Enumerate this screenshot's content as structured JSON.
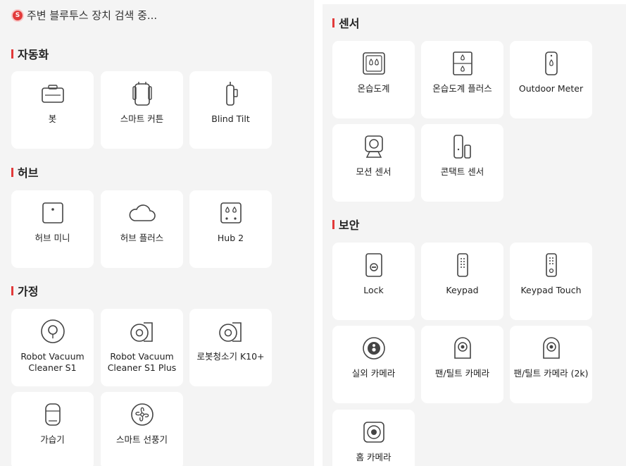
{
  "left": {
    "scan_dot": "S",
    "scan_text": "주변 블루투스 장치 검색 중...",
    "sections": [
      {
        "title": "자동화",
        "items": [
          "봇",
          "스마트 커튼",
          "Blind Tilt"
        ]
      },
      {
        "title": "허브",
        "items": [
          "허브 미니",
          "허브 플러스",
          "Hub 2"
        ]
      },
      {
        "title": "가정",
        "items": [
          "Robot Vacuum Cleaner S1",
          "Robot Vacuum Cleaner S1 Plus",
          "로봇청소기 K10+",
          "가습기",
          "스마트 선풍기"
        ]
      }
    ]
  },
  "right": {
    "sections": [
      {
        "title": "센서",
        "items": [
          "온습도계",
          "온습도계 플러스",
          "Outdoor Meter",
          "모션 센서",
          "콘택트 센서"
        ]
      },
      {
        "title": "보안",
        "items": [
          "Lock",
          "Keypad",
          "Keypad Touch",
          "실외 카메라",
          "팬/틸트 카메라",
          "팬/틸트 카메라 (2k)",
          "홈 카메라"
        ]
      }
    ]
  },
  "colors": {
    "accent": "#e23a3a",
    "card": "#ffffff",
    "panel": "#f4f4f4"
  },
  "icons": {
    "bot": "bot-icon",
    "curtain": "curtain-icon",
    "blind_tilt": "blind-tilt-icon",
    "hub_mini": "hub-mini-icon",
    "hub_plus": "cloud-icon",
    "hub2": "hub2-icon",
    "vacuum_s1": "robot-vacuum-icon",
    "vacuum_s1_plus": "robot-vacuum-dock-icon",
    "vacuum_k10": "robot-vacuum-dock-icon",
    "humidifier": "humidifier-icon",
    "fan": "fan-icon",
    "meter": "thermo-hygrometer-icon",
    "meter_plus": "thermo-hygrometer-plus-icon",
    "outdoor_meter": "outdoor-meter-icon",
    "motion": "motion-sensor-icon",
    "contact": "contact-sensor-icon",
    "lock": "lock-icon",
    "keypad": "keypad-icon",
    "keypad_touch": "keypad-touch-icon",
    "outdoor_cam": "outdoor-camera-icon",
    "pantilt": "pan-tilt-camera-icon",
    "pantilt2k": "pan-tilt-camera-icon",
    "home_cam": "home-camera-icon"
  }
}
